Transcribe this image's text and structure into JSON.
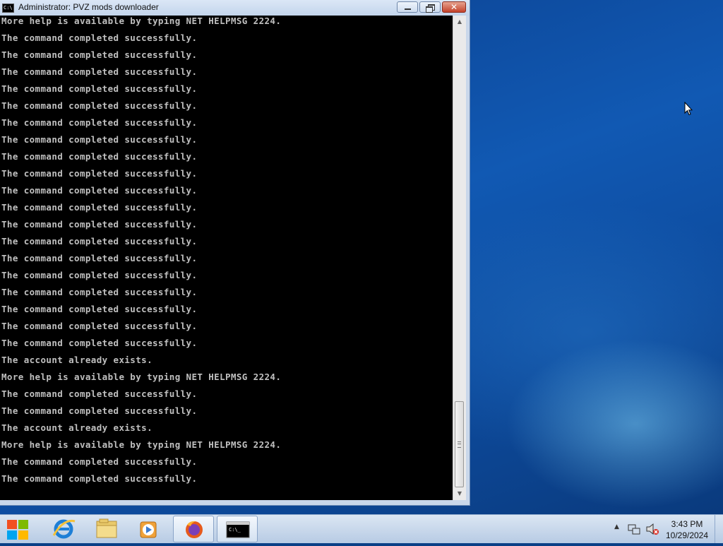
{
  "window": {
    "title": "Administrator:  PVZ mods downloader",
    "icon_text": "C:\\"
  },
  "console_lines": [
    "More help is available by typing NET HELPMSG 2224.",
    "The command completed successfully.",
    "The command completed successfully.",
    "The command completed successfully.",
    "The command completed successfully.",
    "The command completed successfully.",
    "The command completed successfully.",
    "The command completed successfully.",
    "The command completed successfully.",
    "The command completed successfully.",
    "The command completed successfully.",
    "The command completed successfully.",
    "The command completed successfully.",
    "The command completed successfully.",
    "The command completed successfully.",
    "The command completed successfully.",
    "The command completed successfully.",
    "The command completed successfully.",
    "The command completed successfully.",
    "The command completed successfully.",
    "The account already exists.",
    "More help is available by typing NET HELPMSG 2224.",
    "The command completed successfully.",
    "The command completed successfully.",
    "The account already exists.",
    "More help is available by typing NET HELPMSG 2224.",
    "The command completed successfully.",
    "The command completed successfully."
  ],
  "taskbar": {
    "items": [
      {
        "name": "internet-explorer-icon"
      },
      {
        "name": "file-explorer-icon"
      },
      {
        "name": "media-player-icon"
      },
      {
        "name": "firefox-icon"
      },
      {
        "name": "command-prompt-icon"
      }
    ]
  },
  "clock": {
    "time": "3:43 PM",
    "date": "10/29/2024"
  },
  "colors": {
    "console_bg": "#000000",
    "console_text": "#c0c0c0",
    "wallpaper": "#0d4b9e"
  }
}
